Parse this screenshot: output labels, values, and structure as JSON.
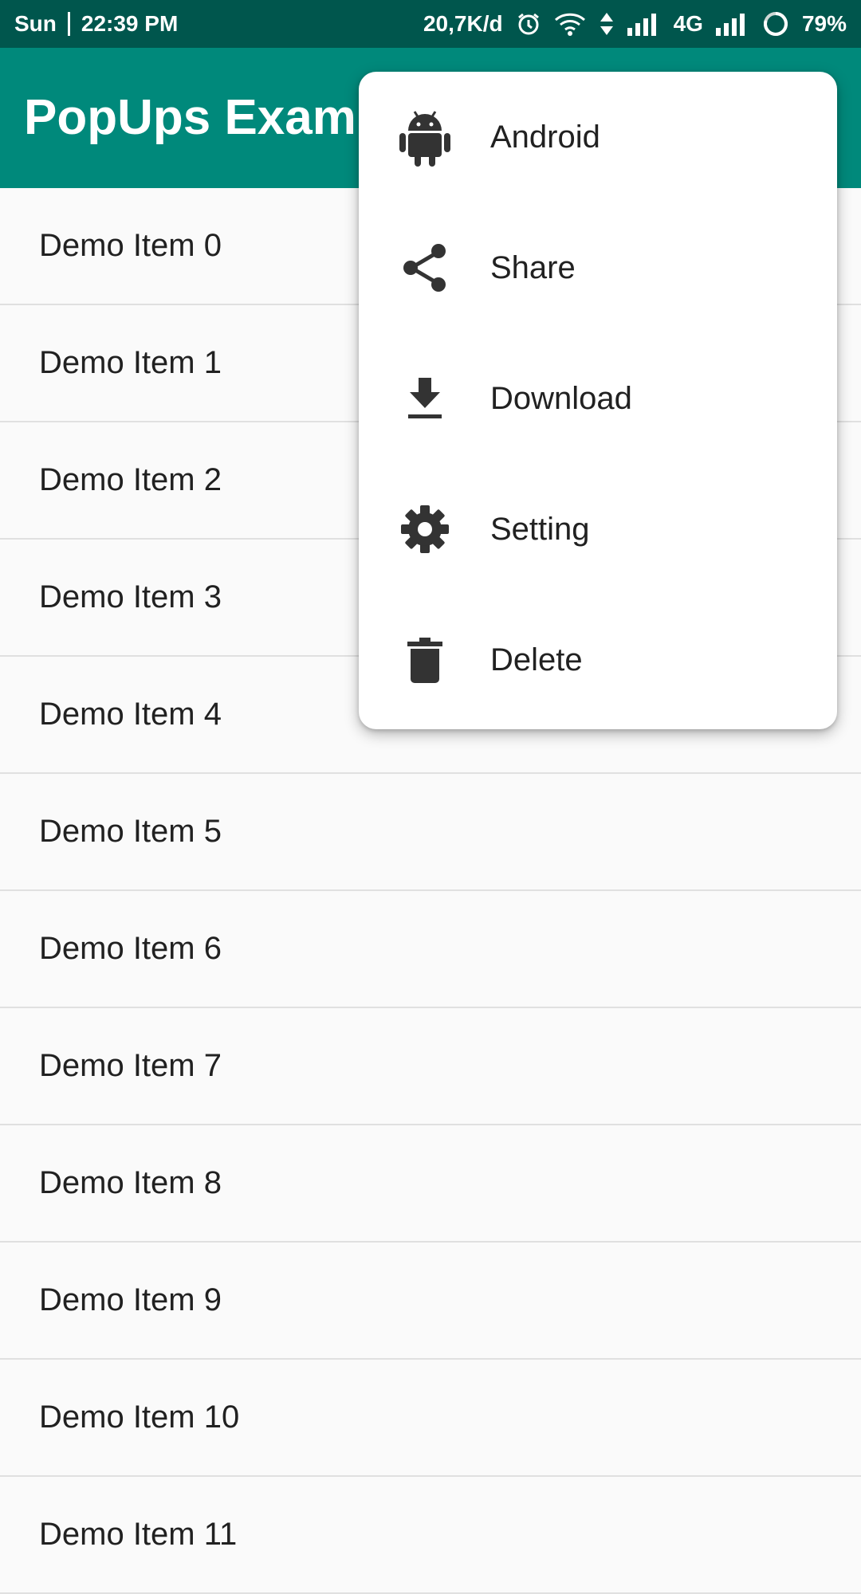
{
  "status_bar": {
    "day": "Sun",
    "time": "22:39 PM",
    "network_speed": "20,7K/d",
    "network_type": "4G",
    "battery": "79%"
  },
  "app_bar": {
    "title": "PopUps Example",
    "background_color": "#00897b"
  },
  "list": {
    "items": [
      "Demo Item 0",
      "Demo Item 1",
      "Demo Item 2",
      "Demo Item 3",
      "Demo Item 4",
      "Demo Item 5",
      "Demo Item 6",
      "Demo Item 7",
      "Demo Item 8",
      "Demo Item 9",
      "Demo Item 10",
      "Demo Item 11"
    ]
  },
  "popup_menu": {
    "items": [
      {
        "label": "Android",
        "icon": "android-icon"
      },
      {
        "label": "Share",
        "icon": "share-icon"
      },
      {
        "label": "Download",
        "icon": "download-icon"
      },
      {
        "label": "Setting",
        "icon": "gear-icon"
      },
      {
        "label": "Delete",
        "icon": "trash-icon"
      }
    ]
  },
  "colors": {
    "status_bar": "#00564d",
    "accent": "#00897b",
    "icon": "#333333"
  }
}
